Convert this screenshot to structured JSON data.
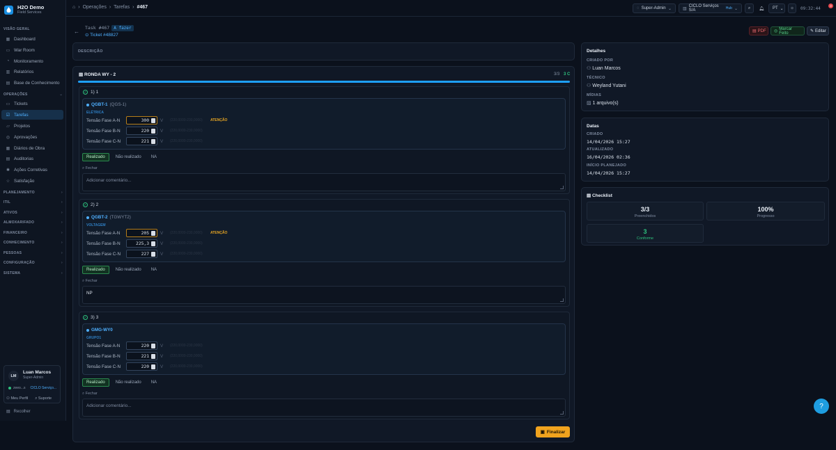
{
  "brand": {
    "title": "H2O Demo",
    "subtitle": "Field Services"
  },
  "sidebar": {
    "visao_geral": "VISÃO GERAL",
    "visao_items": [
      "Dashboard",
      "War Room",
      "Monitoramento",
      "Relatórios",
      "Base de Conhecimento"
    ],
    "operacoes": "OPERAÇÕES",
    "operacoes_items": [
      "Tickets",
      "Tarefas",
      "Projetos",
      "Aprovações",
      "Diários de Obra",
      "Auditorias",
      "Ações Corretivas",
      "Satisfação"
    ],
    "sections": [
      "PLANEJAMENTO",
      "ITIL",
      "ATIVOS",
      "ALMOXARIFADO",
      "FINANCEIRO",
      "CONHECIMENTO",
      "PESSOAS",
      "CONFIGURAÇÃO",
      "SISTEMA"
    ],
    "user": {
      "initials": "LM",
      "name": "Luan Marcos",
      "role": "Super-Admin",
      "status": "zeeo...s",
      "company": "CICLO Serviço...",
      "profile": "Meu Perfil",
      "support": "Suporte"
    },
    "collapse": "Recolher"
  },
  "topbar": {
    "crumbs": [
      "Operações",
      "Tarefas",
      "#467"
    ],
    "role": "Super-Admin",
    "company": "CICLO Serviços S/A",
    "company_tag": "Hub",
    "notif_count": "3",
    "lang": "PT",
    "time": "09:32:44"
  },
  "task": {
    "id": "Task #467",
    "status": "A fazer",
    "ticket": "Ticket #48827",
    "pdf": "PDF",
    "mark_done": "Marcar Feito",
    "edit": "Editar",
    "description_label": "DESCRIÇÃO",
    "round_title": "RONDA WY - 2",
    "progress": "3/3",
    "conform": "3 C",
    "progress_pct": 100
  },
  "items": [
    {
      "title": "1) 1",
      "asset": "QGBT-1",
      "asset_sub": "(QGS-1)",
      "category": "ELÉTRICA",
      "rows": [
        {
          "label": "Tensão Fase A-N",
          "value": "300",
          "unit": "V",
          "range": "(220,0000-230,0000)",
          "alert": "ATENÇÃO"
        },
        {
          "label": "Tensão Fase B-N",
          "value": "220",
          "unit": "V",
          "range": "(220,0000-230,0000)",
          "alert": ""
        },
        {
          "label": "Tensão Fase C-N",
          "value": "221",
          "unit": "V",
          "range": "(220,0000-230,0000)",
          "alert": ""
        }
      ],
      "buttons": [
        "Realizado",
        "Não realizado",
        "NA"
      ],
      "close": "Fechar",
      "comment": "Adicionar comentário..."
    },
    {
      "title": "2) 2",
      "asset": "QGBT-2",
      "asset_sub": "(TGWYT2)",
      "category": "VOLTAGEM",
      "rows": [
        {
          "label": "Tensão Fase A-N",
          "value": "205",
          "unit": "V",
          "range": "(220,0000-230,0000)",
          "alert": "ATENÇÃO"
        },
        {
          "label": "Tensão Fase B-N",
          "value": "225,3",
          "unit": "V",
          "range": "(220,0000-230,0000)",
          "alert": ""
        },
        {
          "label": "Tensão Fase C-N",
          "value": "227",
          "unit": "V",
          "range": "(220,0000-230,0000)",
          "alert": ""
        }
      ],
      "buttons": [
        "Realizado",
        "Não realizado",
        "NA"
      ],
      "close": "Fechar",
      "comment": "NP"
    },
    {
      "title": "3) 3",
      "asset": "GMG-WY0",
      "asset_sub": "",
      "category": "GRUPO1",
      "rows": [
        {
          "label": "Tensão Fase A-N",
          "value": "220",
          "unit": "V",
          "range": "(220,0000-230,0000)",
          "alert": ""
        },
        {
          "label": "Tensão Fase B-N",
          "value": "221",
          "unit": "V",
          "range": "(220,0000-230,0000)",
          "alert": ""
        },
        {
          "label": "Tensão Fase C-N",
          "value": "220",
          "unit": "V",
          "range": "(220,0000-230,0000)",
          "alert": ""
        }
      ],
      "buttons": [
        "Realizado",
        "Não realizado",
        "NA"
      ],
      "close": "Fechar",
      "comment": "Adicionar comentário..."
    }
  ],
  "finalize": "Finalizar",
  "details": {
    "title": "Detalhes",
    "created_by_label": "CRIADO POR",
    "created_by": "Luan Marcos",
    "tech_label": "TÉCNICO",
    "tech": "Weyland Yutani",
    "media_label": "MÍDIAS",
    "media": "1 arquivo(s)"
  },
  "dates": {
    "title": "Datas",
    "created_label": "CRIADO",
    "created": "14/04/2026 15:27",
    "updated_label": "ATUALIZADO",
    "updated": "16/04/2026 02:36",
    "start_label": "INÍCIO PLANEJADO",
    "start": "14/04/2026 15:27"
  },
  "checklist": {
    "title": "Checklist",
    "filled": "3/3",
    "filled_label": "Preenchidos",
    "progress": "100%",
    "progress_label": "Progresso",
    "conform": "3",
    "conform_label": "Conforme"
  },
  "colors": {
    "accent": "#1ea0ff",
    "warning": "#f0a31e",
    "success": "#2ec27e",
    "danger": "#e5484d"
  }
}
